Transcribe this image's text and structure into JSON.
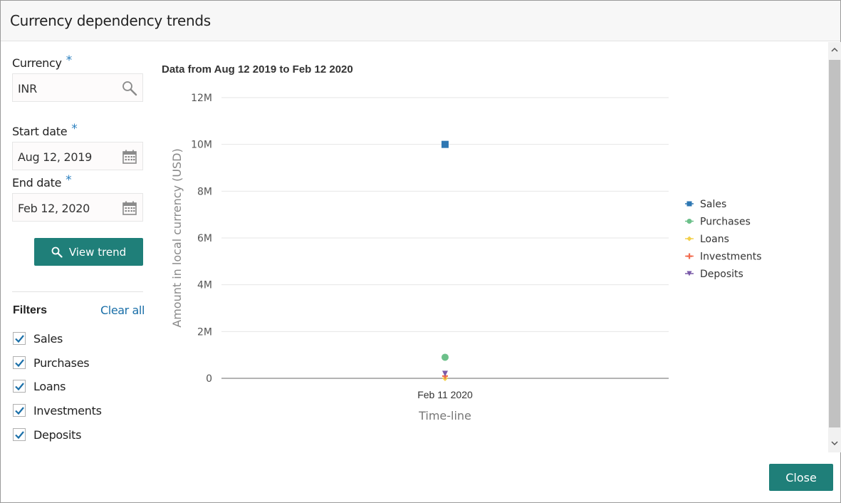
{
  "dialog": {
    "title": "Currency dependency trends",
    "close_label": "Close"
  },
  "form": {
    "currency": {
      "label": "Currency",
      "required": "*",
      "value": "INR",
      "icon": "search-icon"
    },
    "start_date": {
      "label": "Start date",
      "required": "*",
      "value": "Aug 12, 2019",
      "icon": "calendar-icon"
    },
    "end_date": {
      "label": "End date",
      "required": "*",
      "value": "Feb 12, 2020",
      "icon": "calendar-icon"
    },
    "view_trend_label": "View trend"
  },
  "filters": {
    "title": "Filters",
    "clear_all_label": "Clear all",
    "items": [
      {
        "label": "Sales",
        "checked": true
      },
      {
        "label": "Purchases",
        "checked": true
      },
      {
        "label": "Loans",
        "checked": true
      },
      {
        "label": "Investments",
        "checked": true
      },
      {
        "label": "Deposits",
        "checked": true
      }
    ]
  },
  "colors": {
    "accent": "#1f7f79",
    "link": "#1a6fa8",
    "required": "#2a7fbf"
  },
  "chart_data": {
    "type": "scatter",
    "title": "Data from Aug 12 2019 to Feb 12 2020",
    "xlabel": "Time-line",
    "ylabel": "Amount in local currency (USD)",
    "categories": [
      "Feb 11 2020"
    ],
    "ylim": [
      0,
      12000000
    ],
    "yticks": [
      0,
      2000000,
      4000000,
      6000000,
      8000000,
      10000000,
      12000000
    ],
    "ytick_labels": [
      "0",
      "2M",
      "4M",
      "6M",
      "8M",
      "10M",
      "12M"
    ],
    "grid": true,
    "legend": "right",
    "series": [
      {
        "name": "Sales",
        "color": "#2e77b3",
        "marker": "square",
        "values": [
          10000000
        ]
      },
      {
        "name": "Purchases",
        "color": "#6cc08a",
        "marker": "circle",
        "values": [
          900000
        ]
      },
      {
        "name": "Loans",
        "color": "#f2cf4a",
        "marker": "diamond",
        "values": [
          0
        ]
      },
      {
        "name": "Investments",
        "color": "#f26b4e",
        "marker": "cross",
        "values": [
          100000
        ]
      },
      {
        "name": "Deposits",
        "color": "#7a5aa8",
        "marker": "triangle-down",
        "values": [
          200000
        ]
      }
    ]
  }
}
